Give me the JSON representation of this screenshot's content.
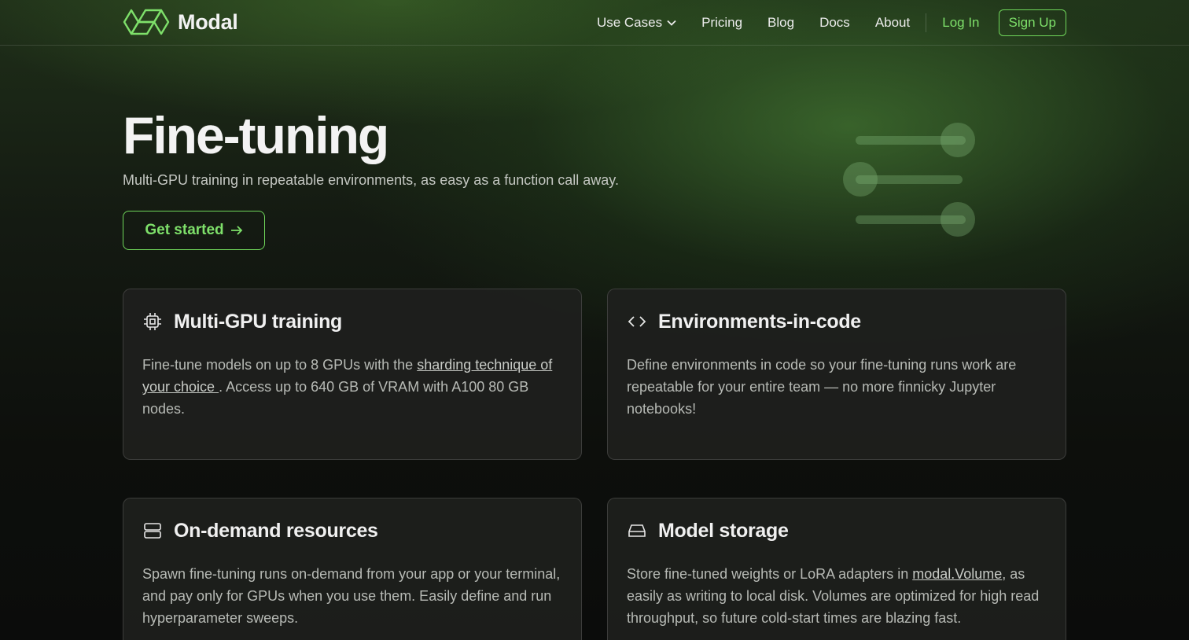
{
  "brand": {
    "name": "Modal",
    "accent": "#7ee06a"
  },
  "nav": {
    "items": [
      {
        "label": "Use Cases",
        "has_dropdown": true
      },
      {
        "label": "Pricing"
      },
      {
        "label": "Blog"
      },
      {
        "label": "Docs"
      },
      {
        "label": "About"
      }
    ],
    "login": "Log In",
    "signup": "Sign Up"
  },
  "hero": {
    "title": "Fine-tuning",
    "subtitle": "Multi-GPU training in repeatable environments, as easy as a function call away.",
    "cta": "Get started"
  },
  "cards": [
    {
      "icon": "cpu-chip-icon",
      "title": "Multi-GPU training",
      "text_before": "Fine-tune models on up to 8 GPUs with the ",
      "link": "sharding technique of your choice ",
      "text_after": ". Access up to 640 GB of VRAM with A100 80 GB nodes."
    },
    {
      "icon": "code-brackets-icon",
      "title": "Environments-in-code",
      "text": "Define environments in code so your fine-tuning runs work are repeatable for your entire team — no more finnicky Jupyter notebooks!"
    },
    {
      "icon": "server-stack-icon",
      "title": "On-demand resources",
      "text": "Spawn fine-tuning runs on-demand from your app or your terminal, and pay only for GPUs when you use them. Easily define and run hyperparameter sweeps."
    },
    {
      "icon": "hard-drive-icon",
      "title": "Model storage",
      "text_before": "Store fine-tuned weights or LoRA adapters in ",
      "link": "modal.Volume",
      "text_after": ", as easily as writing to local disk. Volumes are optimized for high read throughput, so future cold-start times are blazing fast."
    }
  ]
}
